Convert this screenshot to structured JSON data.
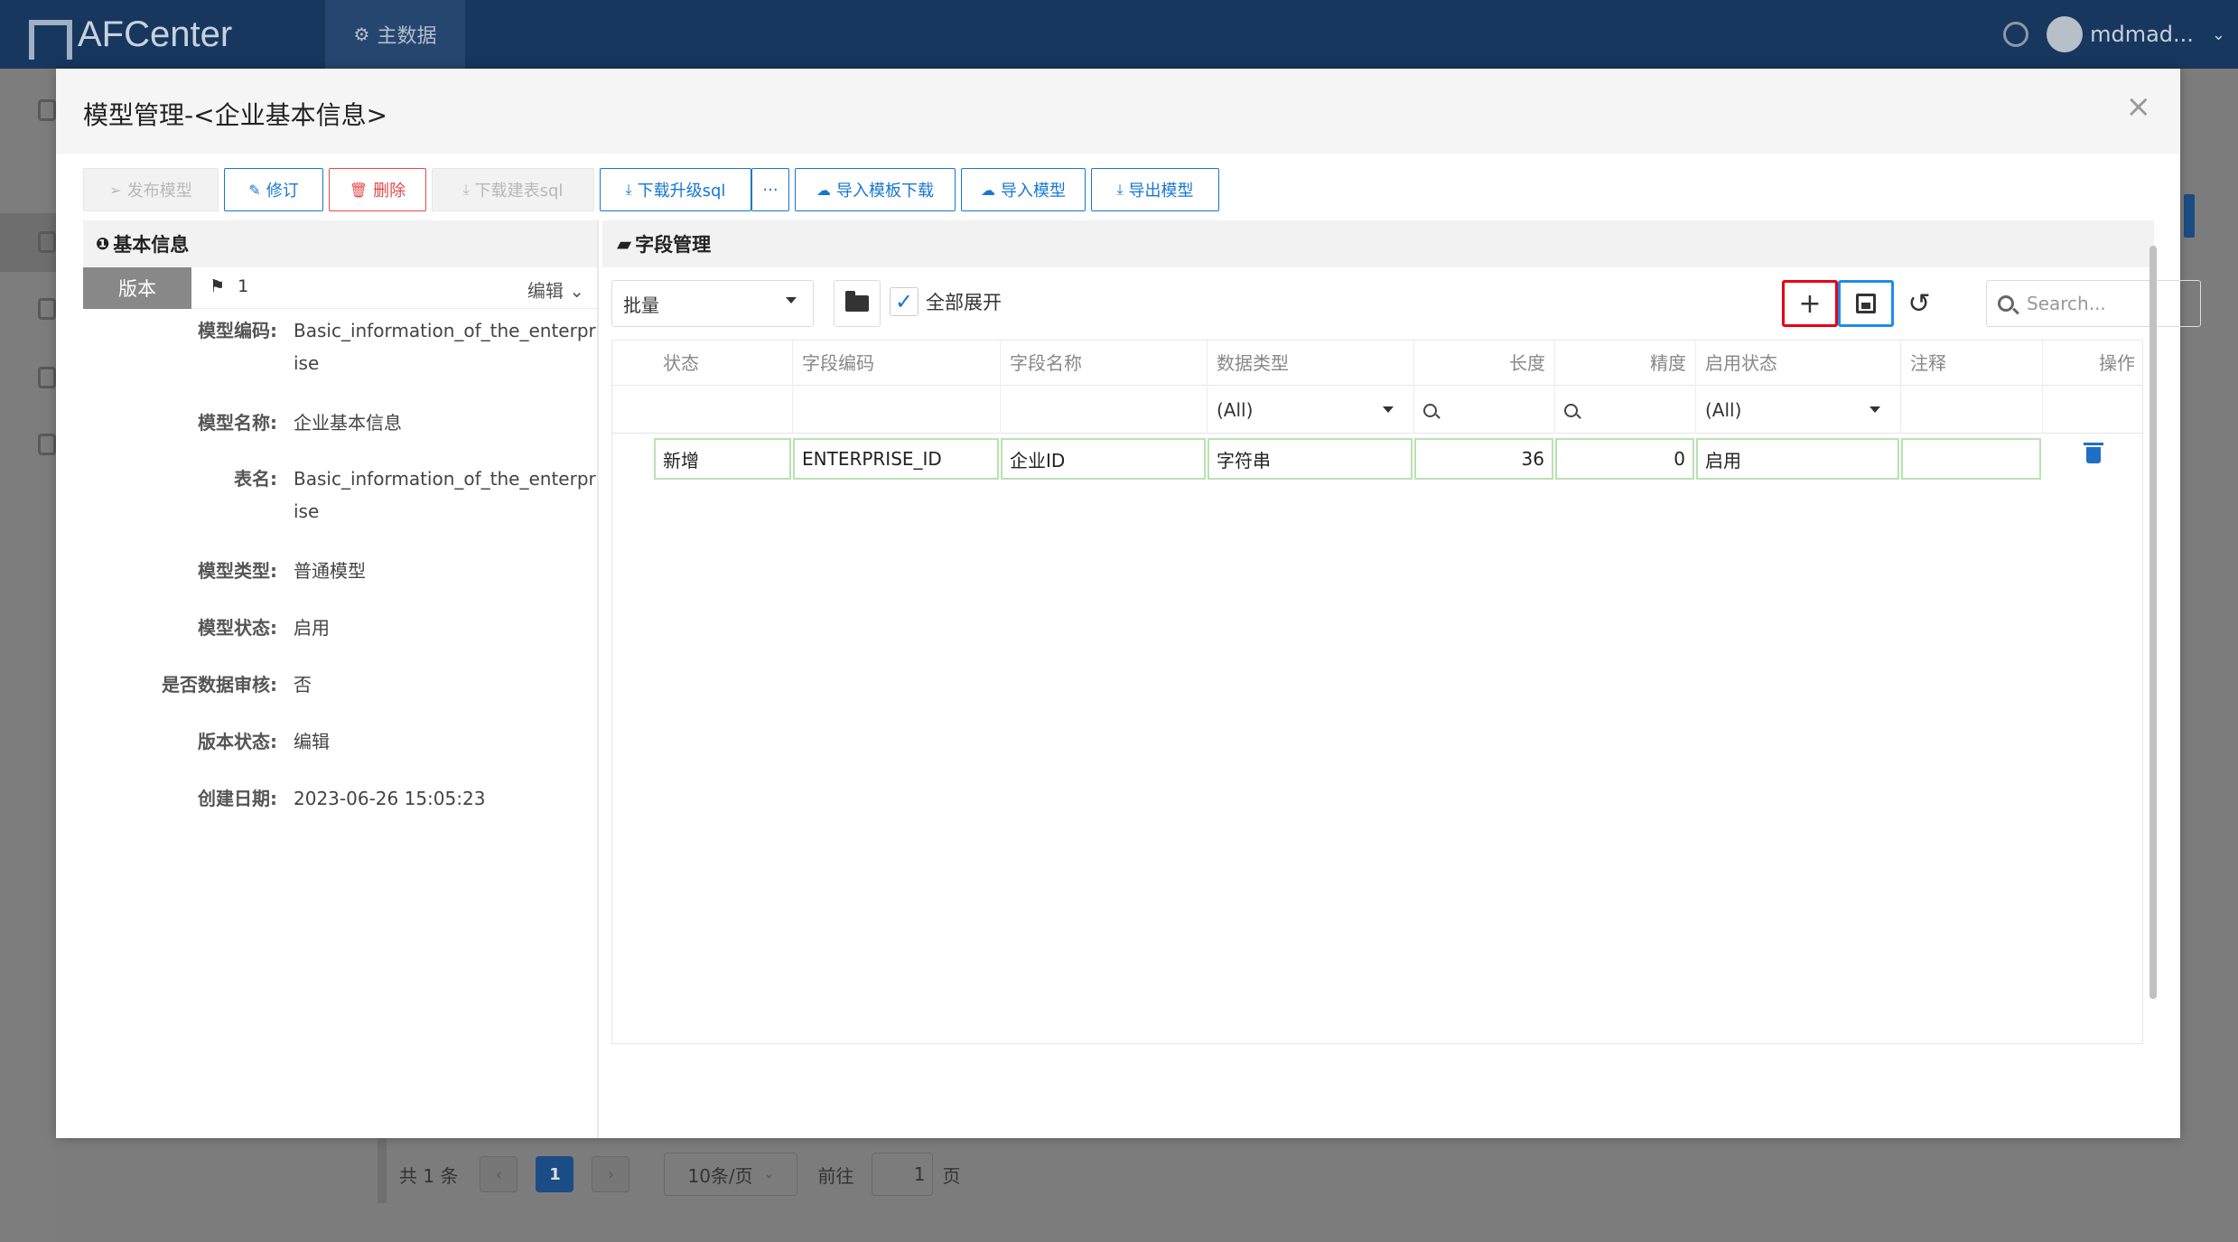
{
  "app": {
    "logo_text": "AFCenter",
    "nav_item": "主数据",
    "user_name": "mdmad..."
  },
  "modal": {
    "title": "模型管理-<企业基本信息>",
    "close_icon": "×"
  },
  "toolbar": {
    "publish": "发布模型",
    "revise": "修订",
    "delete": "删除",
    "download_create_sql": "下载建表sql",
    "download_upgrade_sql": "下载升级sql",
    "more": "···",
    "import_template_download": "导入模板下载",
    "import_model": "导入模型",
    "export_model": "导出模型"
  },
  "basic_info": {
    "header": "基本信息",
    "version_label": "版本",
    "version_value": "1",
    "edit_label": "编辑",
    "fields": [
      {
        "key": "模型编码:",
        "value": "Basic_information_of_the_enterprise"
      },
      {
        "key": "模型名称:",
        "value": "企业基本信息"
      },
      {
        "key": "表名:",
        "value": "Basic_information_of_the_enterprise"
      },
      {
        "key": "模型类型:",
        "value": "普通模型"
      },
      {
        "key": "模型状态:",
        "value": "启用"
      },
      {
        "key": "是否数据审核:",
        "value": "否"
      },
      {
        "key": "版本状态:",
        "value": "编辑"
      },
      {
        "key": "创建日期:",
        "value": "2023-06-26 15:05:23"
      }
    ]
  },
  "field_mgmt": {
    "header": "字段管理",
    "batch_select": "批量",
    "expand_all": "全部展开",
    "search_placeholder": "Search...",
    "columns": [
      "状态",
      "字段编码",
      "字段名称",
      "数据类型",
      "长度",
      "精度",
      "启用状态",
      "注释",
      "操作"
    ],
    "filters": {
      "data_type": "(All)",
      "enable_status": "(All)"
    },
    "rows": [
      {
        "status": "新增",
        "code": "ENTERPRISE_ID",
        "name": "企业ID",
        "type": "字符串",
        "length": "36",
        "precision": "0",
        "enabled": "启用",
        "comment": ""
      }
    ]
  },
  "pager": {
    "total": "共 1 条",
    "prev": "‹",
    "current": "1",
    "next": "›",
    "page_size": "10条/页",
    "goto_label": "前往",
    "goto_value": "1",
    "page_suffix": "页"
  }
}
